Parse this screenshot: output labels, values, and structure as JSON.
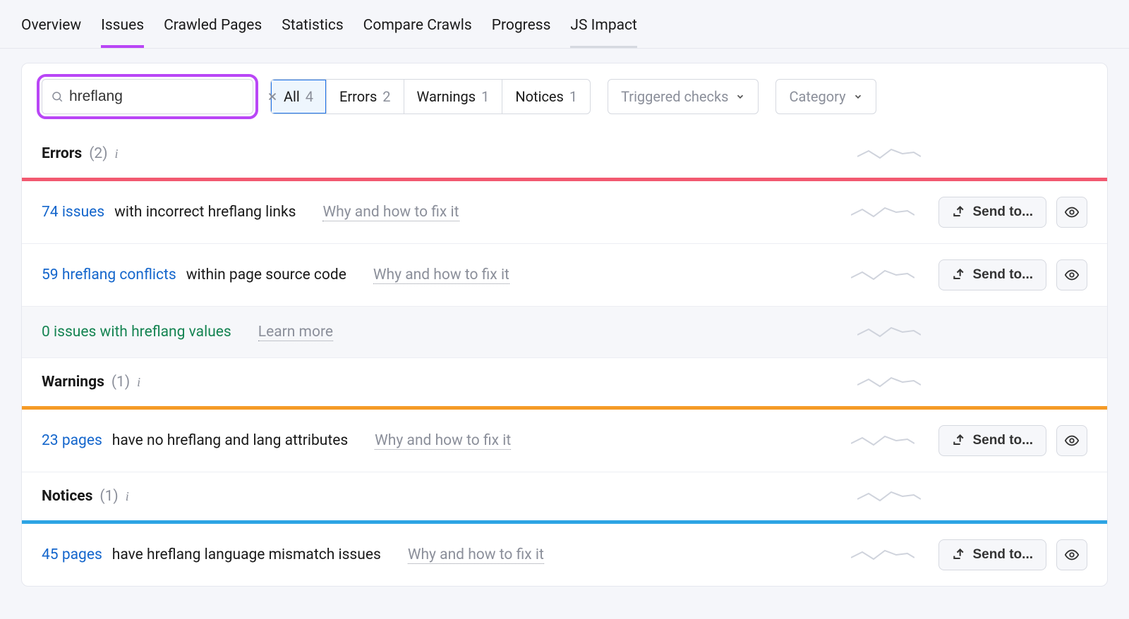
{
  "tabs": [
    "Overview",
    "Issues",
    "Crawled Pages",
    "Statistics",
    "Compare Crawls",
    "Progress",
    "JS Impact"
  ],
  "active_tab_index": 1,
  "recent_tab_index": 6,
  "search_value": "hreflang",
  "seg": {
    "all": {
      "label": "All",
      "count": "4"
    },
    "errors": {
      "label": "Errors",
      "count": "2"
    },
    "warnings": {
      "label": "Warnings",
      "count": "1"
    },
    "notices": {
      "label": "Notices",
      "count": "1"
    }
  },
  "dropdowns": {
    "triggered": "Triggered checks",
    "category": "Category"
  },
  "sections": {
    "errors_title": "Errors",
    "errors_count": "(2)",
    "warnings_title": "Warnings",
    "warnings_count": "(1)",
    "notices_title": "Notices",
    "notices_count": "(1)"
  },
  "help": {
    "why": "Why and how to fix it",
    "learn": "Learn more"
  },
  "actions": {
    "send_to": "Send to..."
  },
  "issues": {
    "err1": {
      "lead": "74 issues",
      "desc": " with incorrect hreflang links"
    },
    "err2": {
      "lead": "59 hreflang conflicts",
      "desc": " within page source code"
    },
    "err3": {
      "lead": "0 issues with hreflang values",
      "desc": ""
    },
    "warn1": {
      "lead": "23 pages",
      "desc": " have no hreflang and lang attributes"
    },
    "not1": {
      "lead": "45 pages",
      "desc": " have hreflang language mismatch issues"
    }
  }
}
